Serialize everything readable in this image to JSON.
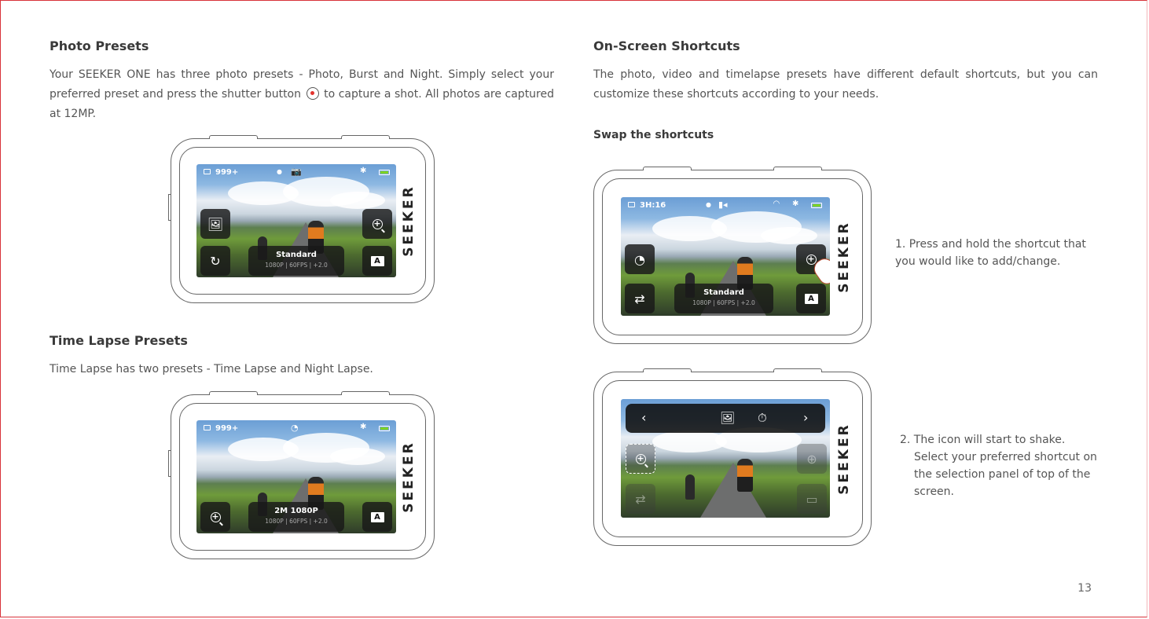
{
  "photo_presets": {
    "title": "Photo Presets",
    "text_before_icon": "Your SEEKER ONE has three photo presets - Photo, Burst and Night. Simply select your preferred preset and press the shutter button",
    "text_after_icon": "to capture a shot. All photos are captured at 12MP.",
    "shutter_icon": "shutter-button-icon"
  },
  "time_lapse_presets": {
    "title": "Time Lapse Presets",
    "text": "Time Lapse has two presets - Time Lapse and Night Lapse."
  },
  "on_screen_shortcuts": {
    "title": "On-Screen Shortcuts",
    "text": "The photo, video and timelapse presets have different default shortcuts, but you can customize these shortcuts according to your needs.",
    "swap_title": "Swap the shortcuts",
    "step1": "1. Press and hold the shortcut that you would like to add/change.",
    "step2_line1": "2. The icon will start to shake.",
    "step2_rest": "Select your preferred shortcut on the selection panel of top of the screen."
  },
  "devices": {
    "brand": "SEEKER",
    "photo": {
      "count": "999+",
      "mode_name": "Standard",
      "mode_specs": "1080P | 60FPS | +2.0",
      "status_icon": "camera-icon"
    },
    "timelapse": {
      "count": "999+",
      "mode_name": "2M 1080P",
      "mode_specs": "1080P | 60FPS | +2.0",
      "status_icon": "timelapse-icon"
    },
    "video": {
      "remaining": "3H:16",
      "mode_name": "Standard",
      "mode_specs": "1080P | 60FPS | +2.0",
      "status_icon": "video-icon"
    },
    "select": {
      "prev": "‹",
      "next": "›"
    }
  },
  "page_number": "13",
  "colors": {
    "accent_red": "#e2332e",
    "battery_green": "#7ed321"
  }
}
